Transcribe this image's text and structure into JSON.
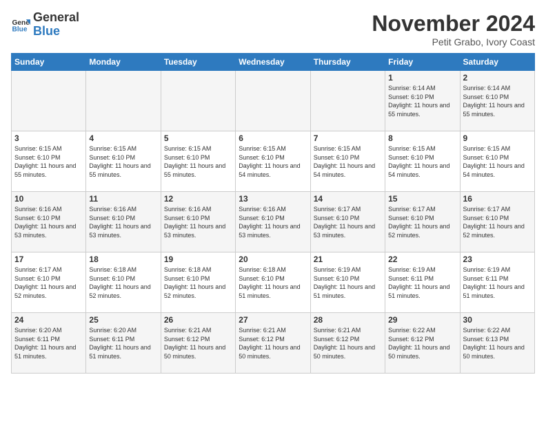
{
  "logo": {
    "text_general": "General",
    "text_blue": "Blue"
  },
  "header": {
    "month_title": "November 2024",
    "subtitle": "Petit Grabo, Ivory Coast"
  },
  "days_of_week": [
    "Sunday",
    "Monday",
    "Tuesday",
    "Wednesday",
    "Thursday",
    "Friday",
    "Saturday"
  ],
  "weeks": [
    {
      "days": [
        {
          "number": "",
          "info": ""
        },
        {
          "number": "",
          "info": ""
        },
        {
          "number": "",
          "info": ""
        },
        {
          "number": "",
          "info": ""
        },
        {
          "number": "",
          "info": ""
        },
        {
          "number": "1",
          "info": "Sunrise: 6:14 AM\nSunset: 6:10 PM\nDaylight: 11 hours and 55 minutes."
        },
        {
          "number": "2",
          "info": "Sunrise: 6:14 AM\nSunset: 6:10 PM\nDaylight: 11 hours and 55 minutes."
        }
      ]
    },
    {
      "days": [
        {
          "number": "3",
          "info": "Sunrise: 6:15 AM\nSunset: 6:10 PM\nDaylight: 11 hours and 55 minutes."
        },
        {
          "number": "4",
          "info": "Sunrise: 6:15 AM\nSunset: 6:10 PM\nDaylight: 11 hours and 55 minutes."
        },
        {
          "number": "5",
          "info": "Sunrise: 6:15 AM\nSunset: 6:10 PM\nDaylight: 11 hours and 55 minutes."
        },
        {
          "number": "6",
          "info": "Sunrise: 6:15 AM\nSunset: 6:10 PM\nDaylight: 11 hours and 54 minutes."
        },
        {
          "number": "7",
          "info": "Sunrise: 6:15 AM\nSunset: 6:10 PM\nDaylight: 11 hours and 54 minutes."
        },
        {
          "number": "8",
          "info": "Sunrise: 6:15 AM\nSunset: 6:10 PM\nDaylight: 11 hours and 54 minutes."
        },
        {
          "number": "9",
          "info": "Sunrise: 6:15 AM\nSunset: 6:10 PM\nDaylight: 11 hours and 54 minutes."
        }
      ]
    },
    {
      "days": [
        {
          "number": "10",
          "info": "Sunrise: 6:16 AM\nSunset: 6:10 PM\nDaylight: 11 hours and 53 minutes."
        },
        {
          "number": "11",
          "info": "Sunrise: 6:16 AM\nSunset: 6:10 PM\nDaylight: 11 hours and 53 minutes."
        },
        {
          "number": "12",
          "info": "Sunrise: 6:16 AM\nSunset: 6:10 PM\nDaylight: 11 hours and 53 minutes."
        },
        {
          "number": "13",
          "info": "Sunrise: 6:16 AM\nSunset: 6:10 PM\nDaylight: 11 hours and 53 minutes."
        },
        {
          "number": "14",
          "info": "Sunrise: 6:17 AM\nSunset: 6:10 PM\nDaylight: 11 hours and 53 minutes."
        },
        {
          "number": "15",
          "info": "Sunrise: 6:17 AM\nSunset: 6:10 PM\nDaylight: 11 hours and 52 minutes."
        },
        {
          "number": "16",
          "info": "Sunrise: 6:17 AM\nSunset: 6:10 PM\nDaylight: 11 hours and 52 minutes."
        }
      ]
    },
    {
      "days": [
        {
          "number": "17",
          "info": "Sunrise: 6:17 AM\nSunset: 6:10 PM\nDaylight: 11 hours and 52 minutes."
        },
        {
          "number": "18",
          "info": "Sunrise: 6:18 AM\nSunset: 6:10 PM\nDaylight: 11 hours and 52 minutes."
        },
        {
          "number": "19",
          "info": "Sunrise: 6:18 AM\nSunset: 6:10 PM\nDaylight: 11 hours and 52 minutes."
        },
        {
          "number": "20",
          "info": "Sunrise: 6:18 AM\nSunset: 6:10 PM\nDaylight: 11 hours and 51 minutes."
        },
        {
          "number": "21",
          "info": "Sunrise: 6:19 AM\nSunset: 6:10 PM\nDaylight: 11 hours and 51 minutes."
        },
        {
          "number": "22",
          "info": "Sunrise: 6:19 AM\nSunset: 6:11 PM\nDaylight: 11 hours and 51 minutes."
        },
        {
          "number": "23",
          "info": "Sunrise: 6:19 AM\nSunset: 6:11 PM\nDaylight: 11 hours and 51 minutes."
        }
      ]
    },
    {
      "days": [
        {
          "number": "24",
          "info": "Sunrise: 6:20 AM\nSunset: 6:11 PM\nDaylight: 11 hours and 51 minutes."
        },
        {
          "number": "25",
          "info": "Sunrise: 6:20 AM\nSunset: 6:11 PM\nDaylight: 11 hours and 51 minutes."
        },
        {
          "number": "26",
          "info": "Sunrise: 6:21 AM\nSunset: 6:12 PM\nDaylight: 11 hours and 50 minutes."
        },
        {
          "number": "27",
          "info": "Sunrise: 6:21 AM\nSunset: 6:12 PM\nDaylight: 11 hours and 50 minutes."
        },
        {
          "number": "28",
          "info": "Sunrise: 6:21 AM\nSunset: 6:12 PM\nDaylight: 11 hours and 50 minutes."
        },
        {
          "number": "29",
          "info": "Sunrise: 6:22 AM\nSunset: 6:12 PM\nDaylight: 11 hours and 50 minutes."
        },
        {
          "number": "30",
          "info": "Sunrise: 6:22 AM\nSunset: 6:13 PM\nDaylight: 11 hours and 50 minutes."
        }
      ]
    }
  ]
}
